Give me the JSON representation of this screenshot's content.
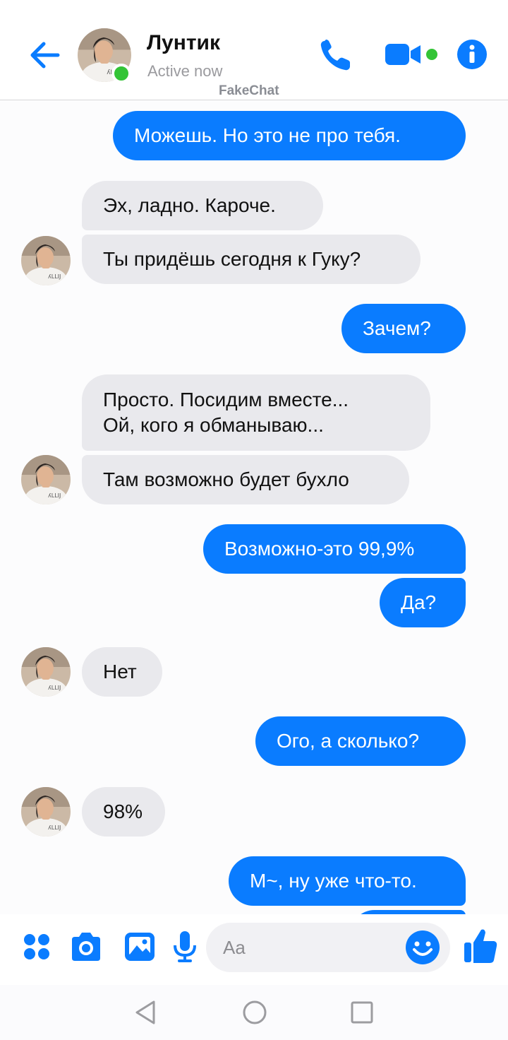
{
  "header": {
    "contact_name": "Лунтик",
    "status": "Active now",
    "watermark": "FakeChat",
    "icons": [
      "back-arrow-icon",
      "phone-icon",
      "video-camera-icon",
      "info-icon"
    ]
  },
  "colors": {
    "accent": "#0a7cff",
    "incoming_bubble": "#e9e9ed",
    "online": "#33c436"
  },
  "messages": [
    {
      "side": "out",
      "text": "Можешь. Но это не про тебя."
    },
    {
      "side": "in",
      "text": "Эх, ладно. Кароче."
    },
    {
      "side": "in",
      "text": "Ты придёшь сегодня к Гуку?"
    },
    {
      "side": "out",
      "text": "Зачем?"
    },
    {
      "side": "in",
      "lines": [
        "Просто. Посидим вместе...",
        "Ой, кого я обманываю..."
      ]
    },
    {
      "side": "in",
      "text": "Там возможно будет бухло"
    },
    {
      "side": "out",
      "text": "Возможно-это 99,9%"
    },
    {
      "side": "out",
      "text": "Да?"
    },
    {
      "side": "in",
      "text": "Нет"
    },
    {
      "side": "out",
      "text": "Ого, а сколько?"
    },
    {
      "side": "in",
      "text": "98%"
    },
    {
      "side": "out",
      "text": "М~, ну уже что-то."
    }
  ],
  "composer": {
    "placeholder": "Aa",
    "icons": [
      "apps-grid-icon",
      "camera-icon",
      "gallery-icon",
      "microphone-icon",
      "emoji-icon",
      "thumbs-up-icon"
    ]
  },
  "navbar": {
    "icons": [
      "nav-back-icon",
      "nav-home-icon",
      "nav-recents-icon"
    ]
  }
}
